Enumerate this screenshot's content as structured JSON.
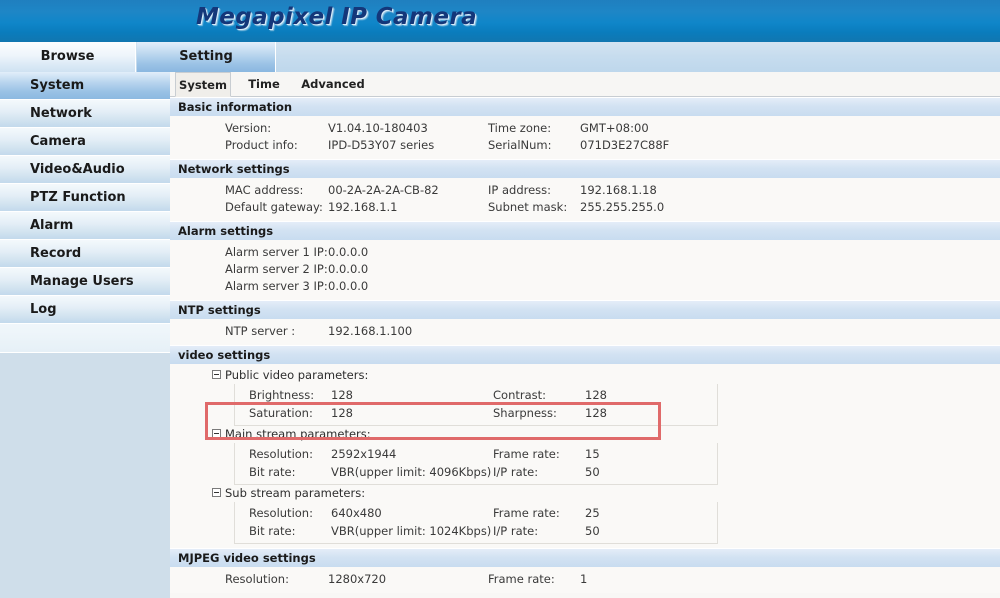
{
  "banner": {
    "title": "Megapixel IP Camera"
  },
  "top_tabs": [
    {
      "label": "Browse",
      "active": false
    },
    {
      "label": "Setting",
      "active": true
    }
  ],
  "sidebar": {
    "items": [
      {
        "label": "System",
        "active": true
      },
      {
        "label": "Network",
        "active": false
      },
      {
        "label": "Camera",
        "active": false
      },
      {
        "label": "Video&Audio",
        "active": false
      },
      {
        "label": "PTZ Function",
        "active": false
      },
      {
        "label": "Alarm",
        "active": false
      },
      {
        "label": "Record",
        "active": false
      },
      {
        "label": "Manage Users",
        "active": false
      },
      {
        "label": "Log",
        "active": false
      }
    ]
  },
  "sub_tabs": [
    {
      "label": "System",
      "active": true
    },
    {
      "label": "Time",
      "active": false
    },
    {
      "label": "Advanced",
      "active": false
    }
  ],
  "sections": {
    "basic_information": {
      "title": "Basic information",
      "rows": [
        {
          "label1": "Version:",
          "value1": "V1.04.10-180403",
          "label2": "Time zone:",
          "value2": "GMT+08:00"
        },
        {
          "label1": "Product info:",
          "value1": "IPD-D53Y07 series",
          "label2": "SerialNum:",
          "value2": "071D3E27C88F"
        }
      ]
    },
    "network_settings": {
      "title": "Network settings",
      "rows": [
        {
          "label1": "MAC address:",
          "value1": "00-2A-2A-2A-CB-82",
          "label2": "IP address:",
          "value2": "192.168.1.18"
        },
        {
          "label1": "Default gateway:",
          "value1": "192.168.1.1",
          "label2": "Subnet mask:",
          "value2": "255.255.255.0"
        }
      ]
    },
    "alarm_settings": {
      "title": "Alarm settings",
      "rows": [
        {
          "label1": "Alarm server 1 IP:",
          "value1": "0.0.0.0",
          "label2": "",
          "value2": ""
        },
        {
          "label1": "Alarm server 2 IP:",
          "value1": "0.0.0.0",
          "label2": "",
          "value2": ""
        },
        {
          "label1": "Alarm server 3 IP:",
          "value1": "0.0.0.0",
          "label2": "",
          "value2": ""
        }
      ]
    },
    "ntp_settings": {
      "title": "NTP settings",
      "rows": [
        {
          "label1": "NTP server :",
          "value1": "192.168.1.100",
          "label2": "",
          "value2": ""
        }
      ]
    },
    "video_settings": {
      "title": "video settings",
      "groups": [
        {
          "icon": "minus-box-icon",
          "label": "Public video parameters:",
          "rows": [
            {
              "label1": "Brightness:",
              "value1": "128",
              "label2": "Contrast:",
              "value2": "128"
            },
            {
              "label1": "Saturation:",
              "value1": "128",
              "label2": "Sharpness:",
              "value2": "128"
            }
          ]
        },
        {
          "icon": "minus-box-icon",
          "label": "Main stream parameters:",
          "rows": [
            {
              "label1": "Resolution:",
              "value1": "2592x1944",
              "label2": "Frame rate:",
              "value2": "15"
            },
            {
              "label1": "Bit rate:",
              "value1": "VBR(upper limit: 4096Kbps)",
              "label2": "I/P rate:",
              "value2": "50"
            }
          ]
        },
        {
          "icon": "minus-box-icon",
          "label": "Sub stream parameters:",
          "rows": [
            {
              "label1": "Resolution:",
              "value1": "640x480",
              "label2": "Frame rate:",
              "value2": "25"
            },
            {
              "label1": "Bit rate:",
              "value1": "VBR(upper limit: 1024Kbps)",
              "label2": "I/P rate:",
              "value2": "50"
            }
          ]
        }
      ]
    },
    "mjpeg_video_settings": {
      "title": "MJPEG video settings",
      "rows": [
        {
          "label1": "Resolution:",
          "value1": "1280x720",
          "label2": "Frame rate:",
          "value2": "1"
        }
      ]
    }
  },
  "annotation": {
    "name": "main-stream-highlight",
    "color": "#e06a6a"
  },
  "colors": {
    "banner_blue": "#0f86c9",
    "title_navy": "#14377a",
    "section_header": "#d2e2f2",
    "sidebar_bg": "#cfdeea",
    "content_bg": "#faf9f7",
    "annotation_red": "#e06a6a"
  }
}
